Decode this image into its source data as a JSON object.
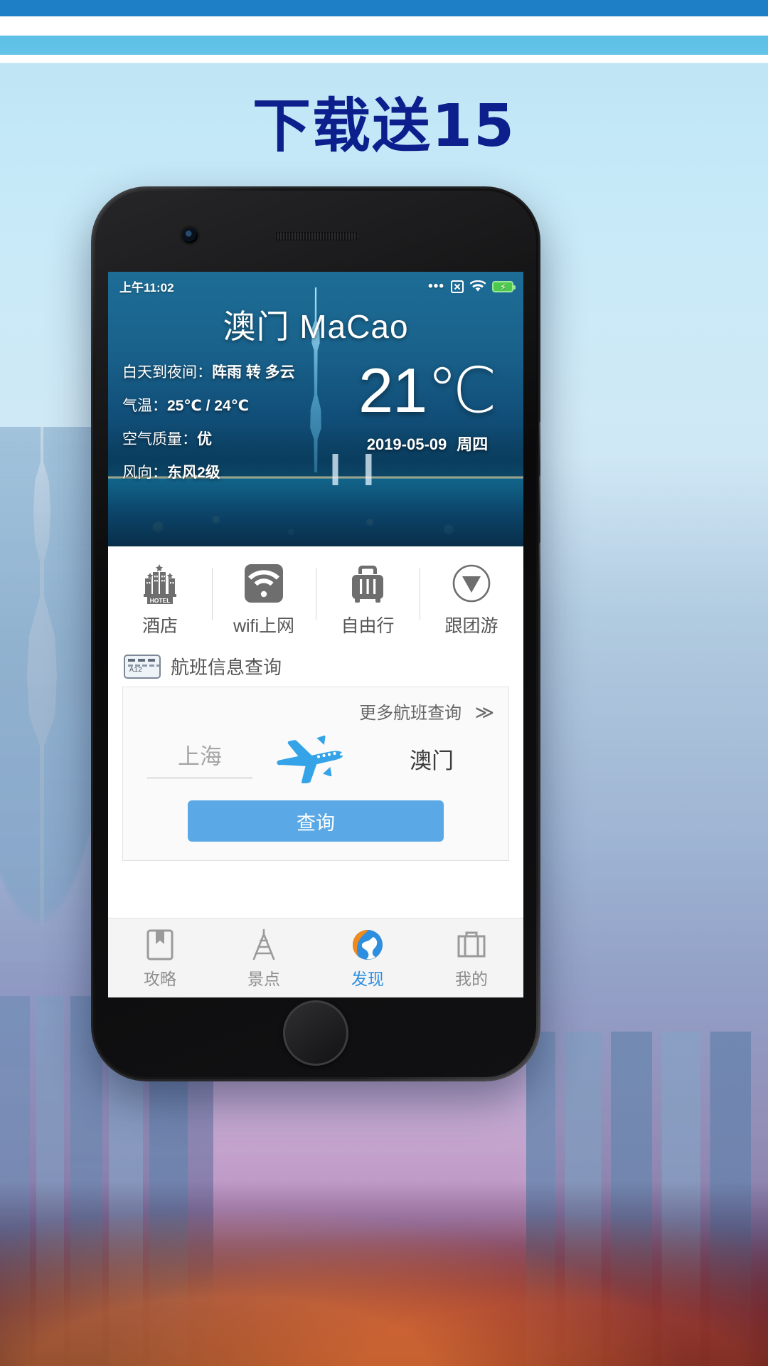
{
  "poster": {
    "headline": "下载送15"
  },
  "phone": {
    "statusbar": {
      "time": "上午11:02",
      "icons": [
        "more-dots-icon",
        "no-signal-icon",
        "wifi-icon",
        "battery-charging-icon"
      ]
    },
    "weather": {
      "city_title": "澳门 MaCao",
      "lines": [
        {
          "label": "白天到夜间：",
          "value": "阵雨 转 多云"
        },
        {
          "label": "气温：",
          "value": "25℃ / 24℃"
        },
        {
          "label": "空气质量：",
          "value": "优"
        },
        {
          "label": "风向：",
          "value": "东风2级"
        }
      ],
      "temperature": "21℃",
      "date": "2019-05-09",
      "weekday": "周四"
    },
    "quick_actions": [
      {
        "icon": "hotel-icon",
        "label": "酒店",
        "badge": "HOTEL"
      },
      {
        "icon": "wifi-square-icon",
        "label": "wifi上网"
      },
      {
        "icon": "suitcase-icon",
        "label": "自由行"
      },
      {
        "icon": "compass-icon",
        "label": "跟团游"
      }
    ],
    "flight": {
      "section_icon": "flight-board-icon",
      "section_icon_text": "A12",
      "section_title": "航班信息查询",
      "more_label": "更多航班查询",
      "more_chevron": "≫",
      "from_city": "上海",
      "to_city": "澳门",
      "plane_icon": "airplane-icon",
      "query_button": "查询"
    },
    "tabbar": [
      {
        "icon": "guide-book-icon",
        "label": "攻略",
        "active": false
      },
      {
        "icon": "tower-icon",
        "label": "景点",
        "active": false
      },
      {
        "icon": "discover-globe-icon",
        "label": "发现",
        "active": true
      },
      {
        "icon": "briefcase-icon",
        "label": "我的",
        "active": false
      }
    ]
  },
  "colors": {
    "headline": "#0d1f8c",
    "accent": "#5aa9e6",
    "active_tab": "#2e8fe0",
    "plane": "#34a3e8"
  }
}
